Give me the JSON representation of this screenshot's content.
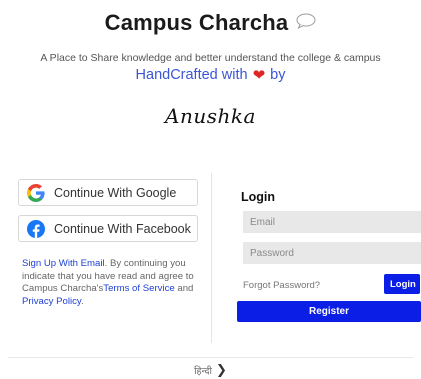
{
  "header": {
    "title": "Campus Charcha",
    "tagline": "A Place to Share knowledge and better understand the college & campus",
    "handcrafted_prefix": "HandCrafted with",
    "handcrafted_suffix": "by",
    "signature": "Anushka"
  },
  "auth": {
    "google_label": "Continue With Google",
    "facebook_label": "Continue With Facebook",
    "legal": {
      "signup_link": "Sign Up With Email",
      "text_1": ". By continuing you indicate that you have read and agree to Campus Charcha's",
      "terms_link": "Terms of Service",
      "text_2": " and ",
      "privacy_link": "Privacy Policy",
      "text_3": "."
    }
  },
  "login": {
    "heading": "Login",
    "email_placeholder": "Email",
    "password_placeholder": "Password",
    "forgot_label": "Forgot Password?",
    "login_label": "Login",
    "register_label": "Register"
  },
  "footer": {
    "language_label": "हिन्दी",
    "chevron": "❯"
  },
  "colors": {
    "accent_blue": "#0b1ee6",
    "link_blue": "#1e3fd6",
    "heart": "#e02424"
  }
}
